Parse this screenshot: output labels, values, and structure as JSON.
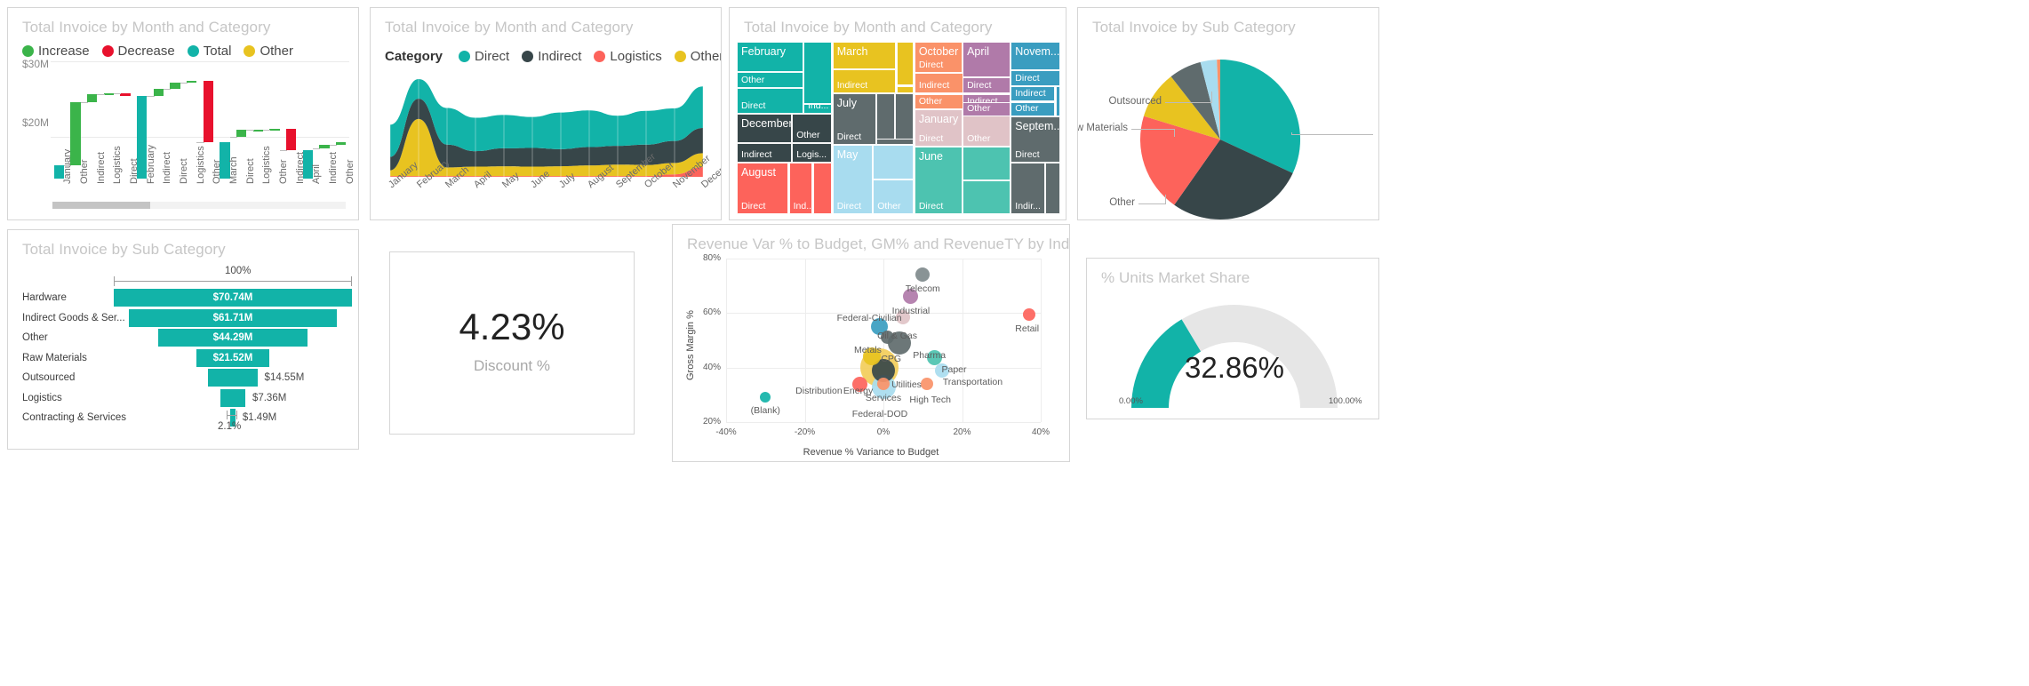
{
  "theme": {
    "teal": "#12b3a8",
    "dark": "#374649",
    "yellow": "#e8c320",
    "red": "#fd635b",
    "green": "#3bb44a",
    "orange": "#fa9269",
    "purple": "#b07aa9",
    "blue": "#3a9dc0",
    "pink": "#e0c3c7",
    "gray": "#5f6b6d",
    "mint": "#4dc3b0",
    "lightblue": "#a8dcef",
    "titleGray": "#c6c6c6"
  },
  "waterfall": {
    "title": "Total Invoice by Month and Category",
    "legend": [
      {
        "label": "Increase",
        "color": "#3bb44a"
      },
      {
        "label": "Decrease",
        "color": "#e8112d"
      },
      {
        "label": "Total",
        "color": "#12b3a8"
      },
      {
        "label": "Other",
        "color": "#e8c320"
      }
    ],
    "scrollbar_position": "left"
  },
  "area": {
    "title": "Total Invoice by Month and Category",
    "legend_title": "Category",
    "legend": [
      {
        "label": "Direct",
        "color": "#12b3a8"
      },
      {
        "label": "Indirect",
        "color": "#374649"
      },
      {
        "label": "Logistics",
        "color": "#fd635b"
      },
      {
        "label": "Other",
        "color": "#e8c320"
      }
    ]
  },
  "treemap": {
    "title": "Total Invoice by Month and Category"
  },
  "pie": {
    "title": "Total Invoice by Sub Category"
  },
  "funnel": {
    "title": "Total Invoice by Sub Category",
    "top_percent": "100%",
    "bottom_percent": "2.1%"
  },
  "kpi": {
    "value": "4.23%",
    "label": "Discount %"
  },
  "scatter": {
    "title": "Revenue Var % to Budget, GM% and RevenueTY by Industry"
  },
  "gauge": {
    "title": "% Units Market Share",
    "value_label": "32.86%",
    "min_label": "0.00%",
    "max_label": "100.00%"
  },
  "chart_data": [
    {
      "id": "waterfall",
      "type": "bar",
      "subtype": "waterfall",
      "title": "Total Invoice by Month and Category",
      "xlabel": "",
      "ylabel": "",
      "ylim": [
        14.5,
        30
      ],
      "yticks": [
        "$20M",
        "$30M"
      ],
      "ytick_values": [
        20,
        30
      ],
      "grid": true,
      "legend": [
        "Increase",
        "Decrease",
        "Total",
        "Other"
      ],
      "legend_position": "top",
      "categories": [
        "January",
        "Other",
        "Indirect",
        "Logistics",
        "Direct",
        "February",
        "Indirect",
        "Direct",
        "Logistics",
        "Other",
        "March",
        "Direct",
        "Logistics",
        "Other",
        "Indirect",
        "April",
        "Indirect",
        "Other"
      ],
      "kinds": [
        "total",
        "increase",
        "increase",
        "increase",
        "decrease",
        "total",
        "increase",
        "increase",
        "increase",
        "decrease",
        "total",
        "increase",
        "increase",
        "increase",
        "decrease",
        "total",
        "increase",
        "increase"
      ],
      "bar_start": [
        14.5,
        16.3,
        24.6,
        25.6,
        25.8,
        14.5,
        25.4,
        26.4,
        27.2,
        19.3,
        14.5,
        20.0,
        20.9,
        21.0,
        18.3,
        14.5,
        18.5,
        19.0
      ],
      "bar_end": [
        16.3,
        24.6,
        25.6,
        25.8,
        25.4,
        25.4,
        26.4,
        27.2,
        27.4,
        27.4,
        19.3,
        20.9,
        21.0,
        21.1,
        21.1,
        18.3,
        19.0,
        19.3
      ]
    },
    {
      "id": "area-stacked",
      "type": "area",
      "subtype": "stacked-smooth",
      "title": "Total Invoice by Month and Category",
      "xlabel": "",
      "ylabel": "",
      "grid": false,
      "legend_title": "Category",
      "legend_position": "top",
      "categories": [
        "January",
        "February",
        "March",
        "April",
        "May",
        "June",
        "July",
        "August",
        "September",
        "October",
        "November",
        "December"
      ],
      "series": [
        {
          "name": "Logistics",
          "color": "#fd635b",
          "values": [
            0.2,
            0.2,
            0.2,
            0.2,
            0.2,
            0.2,
            0.2,
            0.2,
            0.2,
            0.2,
            0.6,
            2.4
          ]
        },
        {
          "name": "Other",
          "color": "#e8c320",
          "values": [
            1.4,
            14.0,
            2.1,
            2.3,
            2.4,
            2.3,
            2.4,
            2.6,
            2.8,
            2.7,
            2.8,
            3.4
          ]
        },
        {
          "name": "Indirect",
          "color": "#374649",
          "values": [
            3.3,
            5.0,
            5.6,
            3.8,
            4.4,
            4.6,
            4.2,
            4.5,
            4.6,
            5.0,
            5.4,
            6.2
          ]
        },
        {
          "name": "Direct",
          "color": "#12b3a8",
          "values": [
            7.9,
            4.8,
            9.0,
            8.2,
            8.2,
            7.6,
            9.0,
            9.0,
            7.4,
            8.3,
            8.0,
            10.2
          ]
        }
      ]
    },
    {
      "id": "treemap",
      "type": "heatmap",
      "subtype": "treemap",
      "title": "Total Invoice by Month and Category",
      "groups": [
        {
          "name": "February",
          "color": "#12b3a8",
          "children": [
            "Other",
            "Direct",
            "Ind..."
          ]
        },
        {
          "name": "December",
          "color": "#374649",
          "children": [
            "Other",
            "Indirect",
            "Logis..."
          ]
        },
        {
          "name": "August",
          "color": "#fd635b",
          "children": [
            "Direct",
            "Ind..."
          ]
        },
        {
          "name": "March",
          "color": "#e8c320",
          "children": [
            "Indirect"
          ]
        },
        {
          "name": "July",
          "color": "#5f6b6d",
          "children": [
            "Direct"
          ]
        },
        {
          "name": "May",
          "color": "#a8dcef",
          "children": [
            "Direct",
            "Other"
          ]
        },
        {
          "name": "October",
          "color": "#fa9269",
          "children": [
            "Direct",
            "Indirect",
            "Other"
          ]
        },
        {
          "name": "January",
          "color": "#e0c3c7",
          "children": [
            "Direct",
            "Other"
          ]
        },
        {
          "name": "June",
          "color": "#4dc3b0",
          "children": [
            "Direct"
          ]
        },
        {
          "name": "April",
          "color": "#b07aa9",
          "children": [
            "Direct",
            "Indirect",
            "Other"
          ]
        },
        {
          "name": "Novem...",
          "color": "#3a9dc0",
          "children": [
            "Direct",
            "Indirect",
            "Other"
          ]
        },
        {
          "name": "Septem...",
          "color": "#5f6b6d",
          "children": [
            "Direct",
            "Indir..."
          ]
        }
      ]
    },
    {
      "id": "pie",
      "type": "pie",
      "title": "Total Invoice by Sub Category",
      "labels": [
        "Hardware",
        "Indirect Goods & Services",
        "Other",
        "Raw Materials",
        "Outsourced",
        "Logistics",
        "Contracting & Services"
      ],
      "values": [
        70.74,
        61.71,
        44.29,
        21.52,
        14.55,
        7.36,
        1.49
      ],
      "colors": [
        "#12b3a8",
        "#374649",
        "#fd635b",
        "#e8c320",
        "#5f6b6d",
        "#a8dcef",
        "#fa9269"
      ],
      "labeled": [
        "Hardware",
        "Indirect Goods & Services",
        "Other",
        "Raw Materials",
        "Outsourced"
      ]
    },
    {
      "id": "funnel",
      "type": "bar",
      "subtype": "funnel",
      "title": "Total Invoice by Sub Category",
      "top_percent": "100%",
      "bottom_percent": "2.1%",
      "categories": [
        "Hardware",
        "Indirect Goods & Ser...",
        "Other",
        "Raw Materials",
        "Outsourced",
        "Logistics",
        "Contracting & Services"
      ],
      "value_labels": [
        "$70.74M",
        "$61.71M",
        "$44.29M",
        "$21.52M",
        "$14.55M",
        "$7.36M",
        "$1.49M"
      ],
      "values": [
        70.74,
        61.71,
        44.29,
        21.52,
        14.55,
        7.36,
        1.49
      ],
      "color": "#12b3a8"
    },
    {
      "id": "kpi-discount",
      "type": "table",
      "subtype": "card",
      "title": "",
      "value": "4.23%",
      "label": "Discount %"
    },
    {
      "id": "scatter-industry",
      "type": "scatter",
      "subtype": "bubble",
      "title": "Revenue Var % to Budget, GM% and RevenueTY by Industry",
      "xlabel": "Revenue % Variance to Budget",
      "ylabel": "Gross Margin %",
      "xlim": [
        -40,
        40
      ],
      "ylim": [
        20,
        80
      ],
      "xticks": [
        "-40%",
        "-20%",
        "0%",
        "20%",
        "40%"
      ],
      "yticks": [
        "20%",
        "40%",
        "60%",
        "80%"
      ],
      "grid": true,
      "points": [
        {
          "name": "Telecom",
          "x": 10,
          "y": 74,
          "size": 16,
          "color": "#7f8a8c"
        },
        {
          "name": "Industrial",
          "x": 7,
          "y": 66,
          "size": 17,
          "color": "#b07aa9"
        },
        {
          "name": "Federal-Civilian",
          "x": 5,
          "y": 58.5,
          "size": 16,
          "color": "#e0c3c7"
        },
        {
          "name": "Oil & Gas",
          "x": -1,
          "y": 55,
          "size": 19,
          "color": "#3a9dc0"
        },
        {
          "name": "Metals",
          "x": 1,
          "y": 51,
          "size": 15,
          "color": "#5f6b6d"
        },
        {
          "name": "Pharma",
          "x": 4,
          "y": 49,
          "size": 26,
          "color": "#5f6b6d"
        },
        {
          "name": "CPG",
          "x": -3,
          "y": 44,
          "size": 20,
          "color": "#e8c320"
        },
        {
          "name": "Paper",
          "x": 13,
          "y": 43.5,
          "size": 17,
          "color": "#4dc3b0"
        },
        {
          "name": "Energy",
          "x": -1,
          "y": 40,
          "size": 43,
          "color": "#f2cd5a"
        },
        {
          "name": "Utilities",
          "x": 0,
          "y": 39,
          "size": 26,
          "color": "#374649"
        },
        {
          "name": "Transportation",
          "x": 15,
          "y": 39,
          "size": 16,
          "color": "#a8dcef"
        },
        {
          "name": "Distribution",
          "x": -6,
          "y": 34,
          "size": 17,
          "color": "#fd635b"
        },
        {
          "name": "Services",
          "x": 0,
          "y": 34,
          "size": 14,
          "color": "#fa9269"
        },
        {
          "name": "Federal-DOD",
          "x": 0,
          "y": 33,
          "size": 27,
          "color": "#a8dcef"
        },
        {
          "name": "High Tech",
          "x": 11,
          "y": 34,
          "size": 14,
          "color": "#fa9269"
        },
        {
          "name": "Retail",
          "x": 37,
          "y": 59.5,
          "size": 14,
          "color": "#fd635b"
        },
        {
          "name": "(Blank)",
          "x": -30,
          "y": 29,
          "size": 12,
          "color": "#12b3a8"
        }
      ]
    },
    {
      "id": "gauge-market-share",
      "type": "pie",
      "subtype": "gauge",
      "title": "% Units Market Share",
      "value": 32.86,
      "value_label": "32.86%",
      "min": 0,
      "max": 100,
      "min_label": "0.00%",
      "max_label": "100.00%",
      "color": "#12b3a8",
      "track_color": "#e6e6e6"
    }
  ]
}
